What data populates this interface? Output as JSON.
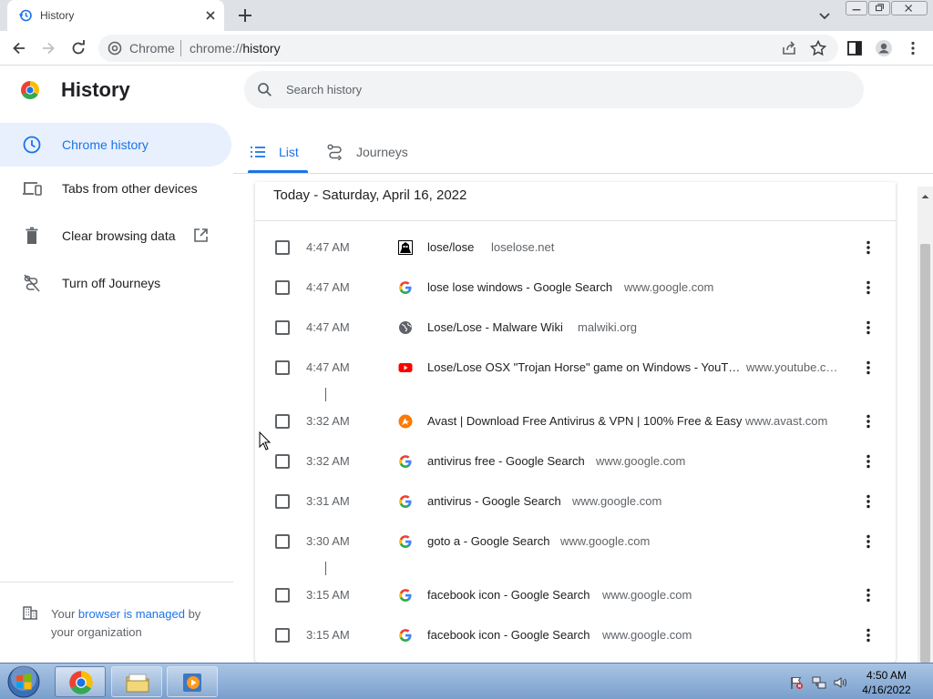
{
  "browser": {
    "tab_title": "History",
    "omnibox_chip": "Chrome",
    "url_scheme": "chrome://",
    "url_path": "history"
  },
  "page": {
    "title": "History",
    "search_placeholder": "Search history"
  },
  "sidebar": {
    "items": [
      {
        "label": "Chrome history",
        "icon": "clock-icon",
        "active": true
      },
      {
        "label": "Tabs from other devices",
        "icon": "devices-icon",
        "active": false
      },
      {
        "label": "Clear browsing data",
        "icon": "trash-icon",
        "active": false
      },
      {
        "label": "Turn off Journeys",
        "icon": "journeys-off-icon",
        "active": false
      }
    ],
    "managed_prefix": "Your ",
    "managed_link": "browser is managed",
    "managed_suffix": " by your organization"
  },
  "view_tabs": [
    {
      "label": "List",
      "icon": "list-icon",
      "active": true
    },
    {
      "label": "Journeys",
      "icon": "journeys-icon",
      "active": false
    }
  ],
  "history": {
    "date_header": "Today - Saturday, April 16, 2022",
    "entries": [
      {
        "time": "4:47 AM",
        "title": "lose/lose",
        "domain": "loselose.net",
        "favicon": "loselose-favicon"
      },
      {
        "time": "4:47 AM",
        "title": "lose lose windows - Google Search",
        "domain": "www.google.com",
        "favicon": "google-favicon"
      },
      {
        "time": "4:47 AM",
        "title": "Lose/Lose - Malware Wiki",
        "domain": "malwiki.org",
        "favicon": "globe-favicon"
      },
      {
        "time": "4:47 AM",
        "title": "Lose/Lose OSX \"Trojan Horse\" game on Windows - YouT…",
        "domain": "www.youtube.c…",
        "favicon": "youtube-favicon"
      },
      {
        "time": "3:32 AM",
        "title": "Avast | Download Free Antivirus & VPN | 100% Free & Easy",
        "domain": "www.avast.com",
        "favicon": "avast-favicon"
      },
      {
        "time": "3:32 AM",
        "title": "antivirus free - Google Search",
        "domain": "www.google.com",
        "favicon": "google-favicon"
      },
      {
        "time": "3:31 AM",
        "title": "antivirus - Google Search",
        "domain": "www.google.com",
        "favicon": "google-favicon"
      },
      {
        "time": "3:30 AM",
        "title": "goto a - Google Search",
        "domain": "www.google.com",
        "favicon": "google-favicon"
      },
      {
        "time": "3:15 AM",
        "title": "facebook icon - Google Search",
        "domain": "www.google.com",
        "favicon": "google-favicon"
      },
      {
        "time": "3:15 AM",
        "title": "facebook icon - Google Search",
        "domain": "www.google.com",
        "favicon": "google-favicon"
      }
    ]
  },
  "taskbar": {
    "clock_time": "4:50 AM",
    "clock_date": "4/16/2022"
  },
  "colors": {
    "accent": "#1a73e8",
    "active_nav_bg": "#e8f0fe",
    "text_secondary": "#5f6368"
  }
}
